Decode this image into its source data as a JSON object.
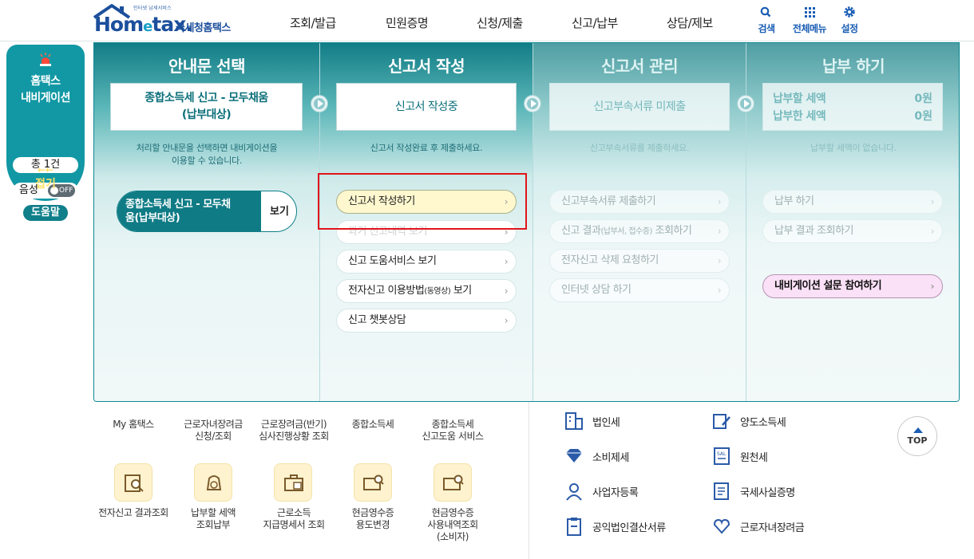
{
  "header": {
    "logo_small": "인터넷 납세서비스",
    "logo_main_1": "Hom",
    "logo_main_e": "e",
    "logo_main_2": "tax.",
    "logo_sub": "국세청홈택스",
    "menu": [
      "조회/발급",
      "민원증명",
      "신청/제출",
      "신고/납부",
      "상담/제보"
    ],
    "utils": [
      {
        "label": "검색",
        "icon": "search-icon"
      },
      {
        "label": "전체메뉴",
        "icon": "grid-menu-icon"
      },
      {
        "label": "설정",
        "icon": "gear-icon"
      }
    ]
  },
  "navigator": {
    "title_line1": "홈택스",
    "title_line2": "내비게이션",
    "count": "총 1건",
    "voice_label": "음성",
    "voice_toggle": "OFF",
    "fold_arrow": "←←",
    "fold_label": "접기",
    "help": "도움말"
  },
  "panel": {
    "columns": [
      {
        "title": "안내문 선택",
        "box_line1": "종합소득세 신고 - 모두채움",
        "box_line2": "(납부대상)",
        "desc_line1": "처리할 안내문을 선택하면 내비게이션을",
        "desc_line2": "이용할 수 있습니다.",
        "notice_line1": "종합소득세 신고 - 모두채",
        "notice_line2": "움(납부대상)",
        "notice_view": "보기"
      },
      {
        "title": "신고서 작성",
        "box": "신고서 작성중",
        "desc": "신고서 작성완료 후 제출하세요.",
        "items": [
          "신고서 작성하기",
          "과거 신고내역 보기",
          "신고 도움서비스 보기",
          "전자신고 이용방법",
          "신고 챗봇상담"
        ],
        "item4_suffix": "(동영상)",
        "item4_tail": " 보기"
      },
      {
        "title": "신고서 관리",
        "box": "신고부속서류 미제출",
        "desc": "신고부속서류를 제출하세요.",
        "items": [
          "신고부속서류 제출하기",
          "신고 결과",
          "전자신고 삭제 요청하기",
          "인터넷 상담 하기"
        ],
        "item2_suffix": "(납부서, 접수증)",
        "item2_tail": " 조회하기"
      },
      {
        "title": "납부 하기",
        "pay_label1": "납부할 세액",
        "pay_amt1": "0원",
        "pay_label2": "납부한 세액",
        "pay_amt2": "0원",
        "desc": "납부할 세액이 없습니다.",
        "items": [
          "납부 하기",
          "납부 결과 조회하기"
        ],
        "survey": "내비게이션 설문 참여하기"
      }
    ]
  },
  "background": {
    "row1_labels": [
      {
        "l1": "My 홈택스",
        "l2": ""
      },
      {
        "l1": "근로자녀장려금",
        "l2": "신청/조회"
      },
      {
        "l1": "근로장려금(반기)",
        "l2": "심사진행상황 조회"
      },
      {
        "l1": "종합소득세",
        "l2": ""
      },
      {
        "l1": "종합소득세",
        "l2": "신고도움 서비스"
      }
    ],
    "row2_labels": [
      {
        "l1": "전자신고 결과조회",
        "l2": "",
        "l3": ""
      },
      {
        "l1": "납부할 세액",
        "l2": "조회납부",
        "l3": ""
      },
      {
        "l1": "근로소득",
        "l2": "지급명세서 조회",
        "l3": ""
      },
      {
        "l1": "현금영수증",
        "l2": "용도변경",
        "l3": ""
      },
      {
        "l1": "현금영수증",
        "l2": "사용내역조회",
        "l3": "(소비자)"
      }
    ],
    "taxes_left": [
      "법인세",
      "소비제세",
      "사업자등록",
      "공익법인결산서류"
    ],
    "taxes_right": [
      "양도소득세",
      "원천세",
      "국세사실증명",
      "근로자녀장려금"
    ],
    "top_button": "TOP"
  }
}
